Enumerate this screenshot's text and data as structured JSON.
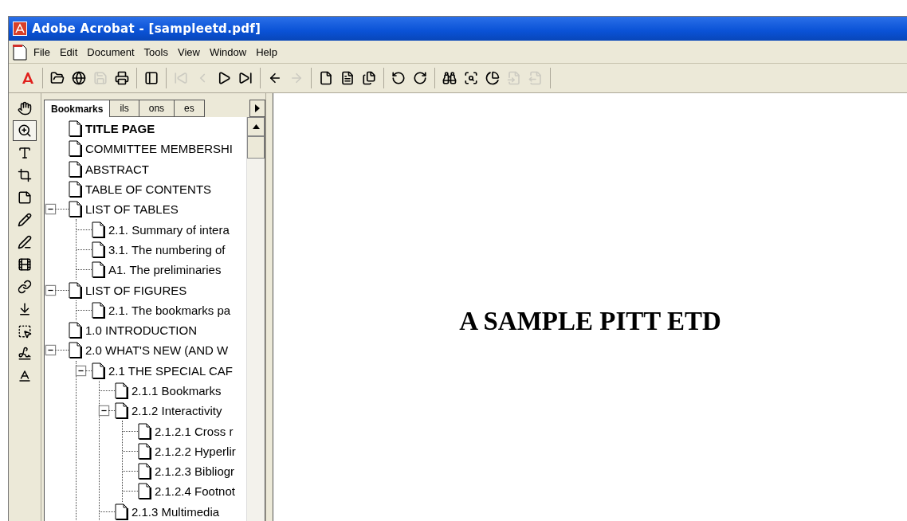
{
  "window": {
    "title": "Adobe Acrobat - [sampleetd.pdf]"
  },
  "menu": [
    "File",
    "Edit",
    "Document",
    "Tools",
    "View",
    "Window",
    "Help"
  ],
  "toolbar": {
    "groups": [
      {
        "buttons": [
          {
            "disabled": false
          }
        ]
      },
      {
        "buttons": [
          {
            "disabled": false
          },
          {
            "disabled": false
          },
          {
            "disabled": true
          },
          {
            "disabled": false
          }
        ]
      },
      {
        "buttons": [
          {
            "disabled": false
          }
        ]
      },
      {
        "buttons": [
          {
            "disabled": true
          },
          {
            "disabled": true
          },
          {
            "disabled": false
          },
          {
            "disabled": false
          }
        ]
      },
      {
        "buttons": [
          {
            "disabled": false
          },
          {
            "disabled": true
          }
        ]
      },
      {
        "buttons": [
          {
            "disabled": false
          },
          {
            "disabled": false
          },
          {
            "disabled": false
          }
        ]
      },
      {
        "buttons": [
          {
            "disabled": false
          },
          {
            "disabled": false
          }
        ]
      },
      {
        "buttons": [
          {
            "disabled": false
          },
          {
            "disabled": false
          },
          {
            "disabled": false
          },
          {
            "disabled": true
          },
          {
            "disabled": true
          }
        ]
      }
    ]
  },
  "tools": [
    {
      "selected": false
    },
    {
      "selected": true
    },
    {
      "selected": false
    },
    {
      "selected": false
    },
    {
      "selected": false
    },
    {
      "selected": false
    },
    {
      "selected": false
    },
    {
      "selected": false
    },
    {
      "selected": false
    },
    {
      "selected": false
    },
    {
      "selected": false
    },
    {
      "selected": false
    },
    {
      "selected": false
    }
  ],
  "panel_tabs": [
    {
      "label": "Bookmarks",
      "selected": true
    },
    {
      "label": "ils",
      "selected": false
    },
    {
      "label": "ons",
      "selected": false
    },
    {
      "label": "es",
      "selected": false
    }
  ],
  "bookmarks": [
    {
      "label": "TITLE PAGE",
      "selected": true
    },
    {
      "label": "COMMITTEE MEMBERSHI",
      "selected": false
    },
    {
      "label": "ABSTRACT",
      "selected": false
    },
    {
      "label": "TABLE OF CONTENTS",
      "selected": false
    },
    {
      "label": "LIST OF TABLES",
      "selected": false,
      "expanded": true,
      "children": [
        {
          "label": "2.1. Summary of intera",
          "selected": false
        },
        {
          "label": "3.1. The numbering of",
          "selected": false
        },
        {
          "label": "A1. The preliminaries",
          "selected": false
        }
      ]
    },
    {
      "label": "LIST OF FIGURES",
      "selected": false,
      "expanded": true,
      "children": [
        {
          "label": "2.1. The bookmarks pa",
          "selected": false
        }
      ]
    },
    {
      "label": "1.0 INTRODUCTION",
      "selected": false
    },
    {
      "label": "2.0 WHAT'S NEW (AND W",
      "selected": false,
      "expanded": true,
      "children": [
        {
          "label": "2.1 THE SPECIAL CAF",
          "selected": false,
          "expanded": true,
          "children": [
            {
              "label": "2.1.1 Bookmarks",
              "selected": false
            },
            {
              "label": "2.1.2 Interactivity",
              "selected": false,
              "expanded": true,
              "children": [
                {
                  "label": "2.1.2.1 Cross r",
                  "selected": false
                },
                {
                  "label": "2.1.2.2 Hyperlir",
                  "selected": false
                },
                {
                  "label": "2.1.2.3 Bibliogr",
                  "selected": false
                },
                {
                  "label": "2.1.2.4 Footnot",
                  "selected": false
                }
              ]
            },
            {
              "label": "2.1.3 Multimedia",
              "selected": false
            }
          ]
        }
      ]
    }
  ],
  "document": {
    "heading": "A SAMPLE PITT ETD"
  }
}
